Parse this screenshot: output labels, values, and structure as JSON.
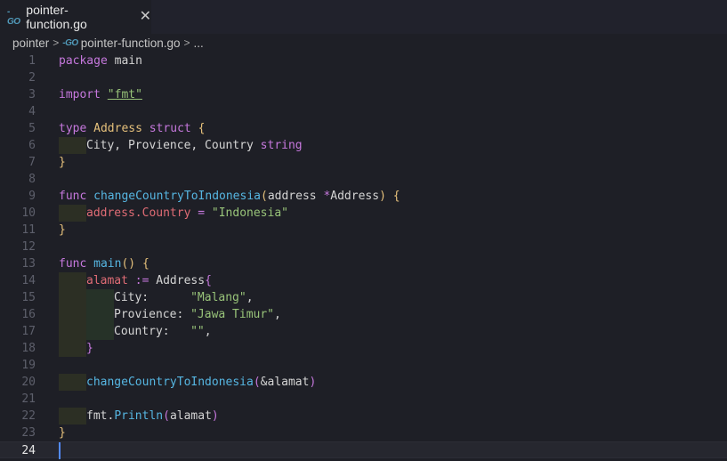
{
  "tab": {
    "icon": "go-file-icon",
    "title": "pointer-function.go",
    "close": "✕"
  },
  "breadcrumb": {
    "folder": "pointer",
    "file": "pointer-function.go",
    "more": "..."
  },
  "editor": {
    "language": "go",
    "current_line": 24,
    "line_numbers": [
      "1",
      "2",
      "3",
      "4",
      "5",
      "6",
      "7",
      "8",
      "9",
      "10",
      "11",
      "12",
      "13",
      "14",
      "15",
      "16",
      "17",
      "18",
      "19",
      "20",
      "21",
      "22",
      "23",
      "24"
    ],
    "tokens": {
      "package": "package",
      "main": "main",
      "import": "import",
      "fmt_str": "\"fmt\"",
      "type": "type",
      "Address": "Address",
      "struct": "struct",
      "fields": "City, Provience, Country ",
      "string": "string",
      "func": "func",
      "changeFn": "changeCountryToIndonesia",
      "param": "address ",
      "star": "*",
      "paramType": "Address",
      "addrCountry": "address.Country",
      "eq": " = ",
      "indo": "\"Indonesia\"",
      "mainFn": "main",
      "parens": "()",
      "alamat": "alamat",
      "assign": " := ",
      "AddressLit": "Address",
      "cityKey": "City:      ",
      "malang": "\"Malang\"",
      "provKey": "Provience: ",
      "jatim": "\"Jawa Timur\"",
      "countryKey": "Country:   ",
      "empty": "\"\"",
      "comma": ",",
      "callArg": "&alamat",
      "fmtPkg": "fmt.",
      "println": "Println",
      "printArg": "alamat"
    }
  },
  "colors": {
    "background": "#1e1f26",
    "keyword": "#c678dd",
    "type": "#e5c07b",
    "function": "#56b6e2",
    "string": "#98c379",
    "variable": "#e06c75"
  }
}
